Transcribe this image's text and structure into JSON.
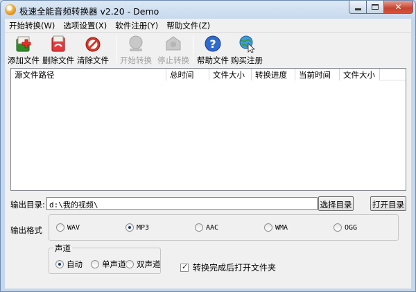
{
  "window": {
    "title": "极速全能音频转换器 v2.20 - Demo"
  },
  "menu": [
    "开始转换(W)",
    "选项设置(X)",
    "软件注册(Y)",
    "帮助文件(Z)"
  ],
  "toolbar": {
    "add": "添加文件",
    "delete": "删除文件",
    "clear": "清除文件",
    "start": "开始转换",
    "stop": "停止转换",
    "help": "帮助文件",
    "buy": "购买注册"
  },
  "list": {
    "columns": [
      "源文件路径",
      "总时间",
      "文件大小",
      "转换进度",
      "当前时间",
      "文件大小"
    ]
  },
  "output": {
    "dir_label": "输出目录:",
    "dir_value": "d:\\我的视频\\",
    "choose_btn": "选择目录",
    "open_btn": "打开目录"
  },
  "format": {
    "label": "输出格式",
    "options": [
      "WAV",
      "MP3",
      "AAC",
      "WMA",
      "OGG"
    ],
    "selected": "MP3"
  },
  "channel": {
    "title": "声道",
    "options": [
      "自动",
      "单声道",
      "双声道"
    ],
    "selected": "自动"
  },
  "open_after": {
    "label": "转换完成后打开文件夹",
    "checked": true
  }
}
